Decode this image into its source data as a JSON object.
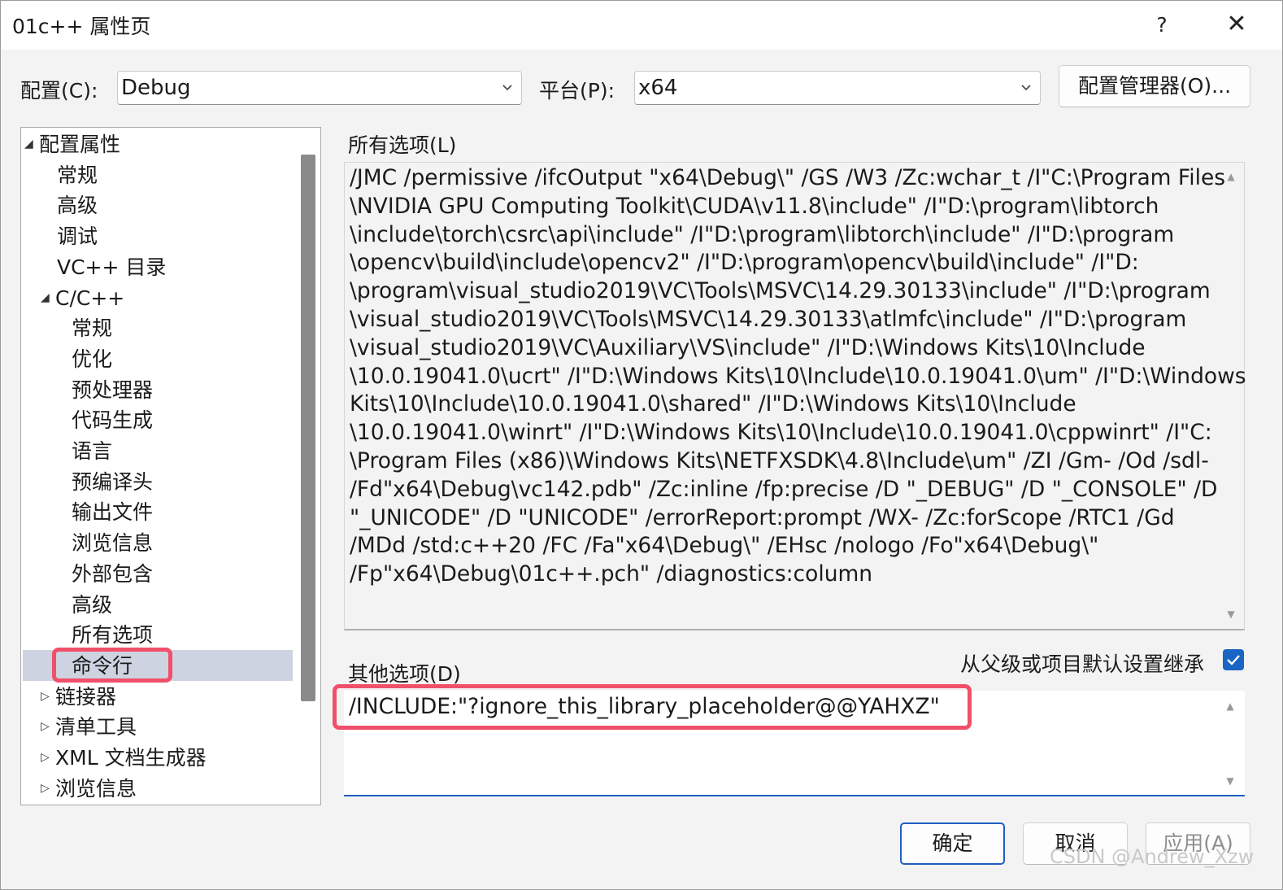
{
  "window": {
    "title": "01c++ 属性页",
    "help_label": "?",
    "close_label": "✕"
  },
  "config_row": {
    "config_label": "配置(C):",
    "config_value": "Debug",
    "platform_label": "平台(P):",
    "platform_value": "x64",
    "manager_button": "配置管理器(O)..."
  },
  "tree": {
    "items": [
      {
        "label": "配置属性",
        "arrow": "◢",
        "level": 0
      },
      {
        "label": "常规",
        "arrow": "",
        "level": 1
      },
      {
        "label": "高级",
        "arrow": "",
        "level": 1
      },
      {
        "label": "调试",
        "arrow": "",
        "level": 1
      },
      {
        "label": "VC++ 目录",
        "arrow": "",
        "level": 1
      },
      {
        "label": "C/C++",
        "arrow": "◢",
        "level": 1
      },
      {
        "label": "常规",
        "arrow": "",
        "level": 2
      },
      {
        "label": "优化",
        "arrow": "",
        "level": 2
      },
      {
        "label": "预处理器",
        "arrow": "",
        "level": 2
      },
      {
        "label": "代码生成",
        "arrow": "",
        "level": 2
      },
      {
        "label": "语言",
        "arrow": "",
        "level": 2
      },
      {
        "label": "预编译头",
        "arrow": "",
        "level": 2
      },
      {
        "label": "输出文件",
        "arrow": "",
        "level": 2
      },
      {
        "label": "浏览信息",
        "arrow": "",
        "level": 2
      },
      {
        "label": "外部包含",
        "arrow": "",
        "level": 2
      },
      {
        "label": "高级",
        "arrow": "",
        "level": 2
      },
      {
        "label": "所有选项",
        "arrow": "",
        "level": 2
      },
      {
        "label": "命令行",
        "arrow": "",
        "level": 2,
        "selected": true
      },
      {
        "label": "链接器",
        "arrow": "▷",
        "level": 1
      },
      {
        "label": "清单工具",
        "arrow": "▷",
        "level": 1
      },
      {
        "label": "XML 文档生成器",
        "arrow": "▷",
        "level": 1
      },
      {
        "label": "浏览信息",
        "arrow": "▷",
        "level": 1
      }
    ]
  },
  "all_options": {
    "label": "所有选项(L)",
    "lines": [
      "/JMC /permissive /ifcOutput \"x64\\Debug\\\" /GS /W3 /Zc:wchar_t /I\"C:\\Program Files",
      "\\NVIDIA GPU Computing Toolkit\\CUDA\\v11.8\\include\" /I\"D:\\program\\libtorch",
      "\\include\\torch\\csrc\\api\\include\" /I\"D:\\program\\libtorch\\include\" /I\"D:\\program",
      "\\opencv\\build\\include\\opencv2\" /I\"D:\\program\\opencv\\build\\include\" /I\"D:",
      "\\program\\visual_studio2019\\VC\\Tools\\MSVC\\14.29.30133\\include\" /I\"D:\\program",
      "\\visual_studio2019\\VC\\Tools\\MSVC\\14.29.30133\\atlmfc\\include\" /I\"D:\\program",
      "\\visual_studio2019\\VC\\Auxiliary\\VS\\include\" /I\"D:\\Windows Kits\\10\\Include",
      "\\10.0.19041.0\\ucrt\" /I\"D:\\Windows Kits\\10\\Include\\10.0.19041.0\\um\" /I\"D:\\Windows",
      "Kits\\10\\Include\\10.0.19041.0\\shared\" /I\"D:\\Windows Kits\\10\\Include",
      "\\10.0.19041.0\\winrt\" /I\"D:\\Windows Kits\\10\\Include\\10.0.19041.0\\cppwinrt\" /I\"C:",
      "\\Program Files (x86)\\Windows Kits\\NETFXSDK\\4.8\\Include\\um\" /ZI /Gm- /Od /sdl-",
      "/Fd\"x64\\Debug\\vc142.pdb\" /Zc:inline /fp:precise /D \"_DEBUG\" /D \"_CONSOLE\" /D",
      "\"_UNICODE\" /D \"UNICODE\" /errorReport:prompt /WX- /Zc:forScope /RTC1 /Gd",
      "/MDd /std:c++20 /FC /Fa\"x64\\Debug\\\" /EHsc /nologo /Fo\"x64\\Debug\\\"",
      "/Fp\"x64\\Debug\\01c++.pch\" /diagnostics:column"
    ]
  },
  "other_options": {
    "label": "其他选项(D)",
    "inherit_label": "从父级或项目默认设置继承",
    "inherit_checked": true,
    "value": "/INCLUDE:\"?ignore_this_library_placeholder@@YAHXZ\""
  },
  "buttons": {
    "ok": "确定",
    "cancel": "取消",
    "apply": "应用(A)"
  },
  "watermark": "CSDN @Andrew_Xzw",
  "colors": {
    "highlight": "#f0506a",
    "accent": "#1964c4",
    "selection": "#cdd3e0"
  }
}
